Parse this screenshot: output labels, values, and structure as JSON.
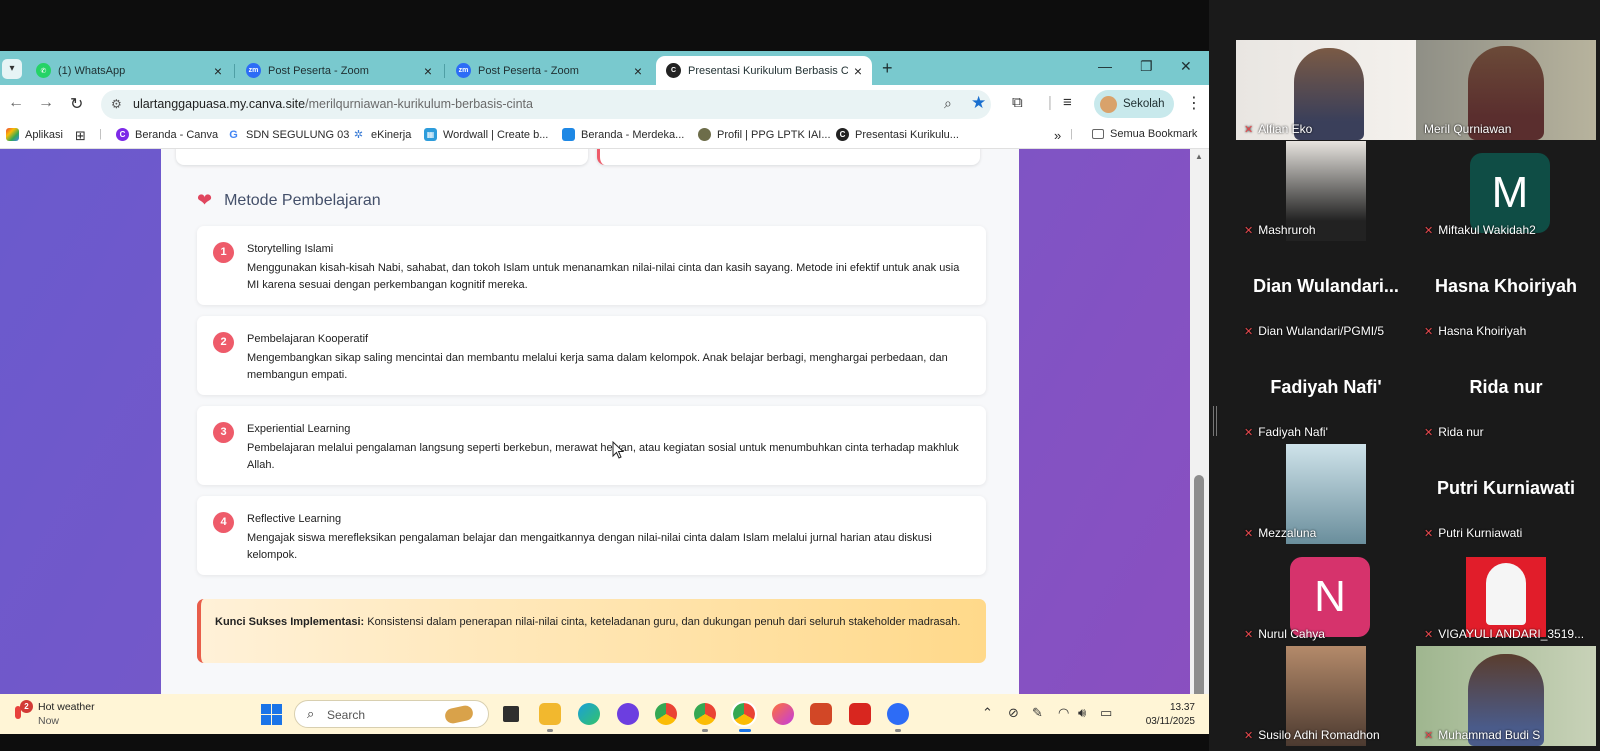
{
  "browser": {
    "tabs": [
      {
        "label": "(1) WhatsApp",
        "icon": "whatsapp-icon",
        "active": false
      },
      {
        "label": "Post Peserta - Zoom",
        "icon": "zoom-icon",
        "active": false
      },
      {
        "label": "Post Peserta - Zoom",
        "icon": "zoom-icon",
        "active": false
      },
      {
        "label": "Presentasi Kurikulum Berbasis C",
        "icon": "canva-icon",
        "active": true
      }
    ],
    "address": {
      "domain": "ulartanggapuasa.my.canva.site",
      "path": "/merilqurniawan-kurikulum-berbasis-cinta"
    },
    "profile_label": "Sekolah",
    "bookmarks": [
      {
        "label": "Aplikasi",
        "icon": "apps-grid-icon"
      },
      {
        "label": "Beranda - Canva",
        "icon": "canva-icon"
      },
      {
        "label": "SDN SEGULUNG 03",
        "icon": "google-icon"
      },
      {
        "label": "eKinerja",
        "icon": "ekinerja-icon"
      },
      {
        "label": "Wordwall | Create b...",
        "icon": "wordwall-icon"
      },
      {
        "label": "Beranda - Merdeka...",
        "icon": "merdeka-icon"
      },
      {
        "label": "Profil | PPG LPTK IAI...",
        "icon": "ppg-icon"
      },
      {
        "label": "Presentasi Kurikulu...",
        "icon": "canva-icon"
      }
    ],
    "bookmarks_more": "»",
    "all_bookmarks": "Semua Bookmark"
  },
  "page": {
    "section_title": "Metode Pembelajaran",
    "methods": [
      {
        "num": "1",
        "title": "Storytelling Islami",
        "desc": "Menggunakan kisah-kisah Nabi, sahabat, dan tokoh Islam untuk menanamkan nilai-nilai cinta dan kasih sayang. Metode ini efektif untuk anak usia MI karena sesuai dengan perkembangan kognitif mereka."
      },
      {
        "num": "2",
        "title": "Pembelajaran Kooperatif",
        "desc": "Mengembangkan sikap saling mencintai dan membantu melalui kerja sama dalam kelompok. Anak belajar berbagi, menghargai perbedaan, dan membangun empati."
      },
      {
        "num": "3",
        "title": "Experiential Learning",
        "desc": "Pembelajaran melalui pengalaman langsung seperti berkebun, merawat hewan, atau kegiatan sosial untuk menumbuhkan cinta terhadap makhluk Allah."
      },
      {
        "num": "4",
        "title": "Reflective Learning",
        "desc": "Mengajak siswa merefleksikan pengalaman belajar dan mengaitkannya dengan nilai-nilai cinta dalam Islam melalui jurnal harian atau diskusi kelompok."
      }
    ],
    "key_label": "Kunci Sukses Implementasi:",
    "key_text": " Konsistensi dalam penerapan nilai-nilai cinta, keteladanan guru, dan dukungan penuh dari seluruh stakeholder madrasah."
  },
  "taskbar": {
    "weather_title": "Hot weather",
    "weather_sub": "Now",
    "weather_badge": "2",
    "search_placeholder": "Search",
    "time": "13.37",
    "date": "03/11/2025"
  },
  "zoom": {
    "participants": [
      {
        "name": "Alfian Eko",
        "display": "",
        "video": true,
        "avatar_letter": "",
        "speaking": false
      },
      {
        "name": "Meril Qurniawan",
        "display": "",
        "video": true,
        "avatar_letter": "",
        "speaking": true
      },
      {
        "name": "Mashruroh",
        "display": "",
        "video": true,
        "avatar_letter": "",
        "speaking": false
      },
      {
        "name": "Miftakul Wakidah2",
        "display": "",
        "video": false,
        "avatar_letter": "M",
        "avatar_color": "#0f4d45",
        "speaking": false
      },
      {
        "name": "Dian Wulandari/PGMI/5",
        "display": "Dian  Wulandari...",
        "video": false,
        "avatar_letter": "",
        "speaking": false
      },
      {
        "name": "Hasna Khoiriyah",
        "display": "Hasna Khoiriyah",
        "video": false,
        "avatar_letter": "",
        "speaking": false
      },
      {
        "name": "Fadiyah Nafi'",
        "display": "Fadiyah Nafi'",
        "video": false,
        "avatar_letter": "",
        "speaking": false
      },
      {
        "name": "Rida nur",
        "display": "Rida nur",
        "video": false,
        "avatar_letter": "",
        "speaking": false
      },
      {
        "name": "Mezzaluna",
        "display": "",
        "video": true,
        "avatar_letter": "",
        "speaking": false
      },
      {
        "name": "Putri Kurniawati",
        "display": "Putri Kurniawati",
        "video": false,
        "avatar_letter": "",
        "speaking": false
      },
      {
        "name": "Nurul Cahya",
        "display": "",
        "video": false,
        "avatar_letter": "N",
        "avatar_color": "#d6336c",
        "speaking": false
      },
      {
        "name": "VIGAYULI ANDARI_3519...",
        "display": "",
        "video": true,
        "avatar_letter": "",
        "speaking": false
      },
      {
        "name": "Susilo Adhi Romadhon",
        "display": "",
        "video": true,
        "avatar_letter": "",
        "speaking": false
      },
      {
        "name": "Muhammad Budi S",
        "display": "",
        "video": true,
        "avatar_letter": "",
        "speaking": false
      }
    ]
  }
}
